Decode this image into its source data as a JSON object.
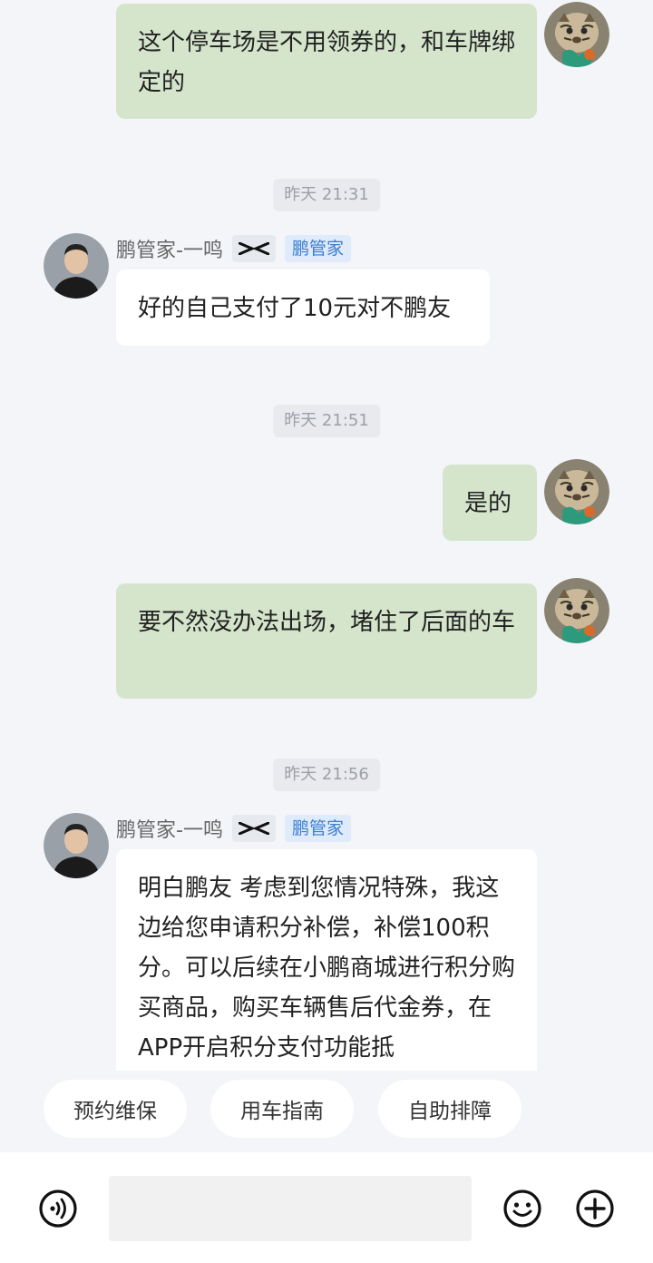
{
  "messages": [
    {
      "direction": "out",
      "text": "这个停车场是不用领券的，和车牌绑定的"
    },
    {
      "timestamp": "昨天 21:31"
    },
    {
      "direction": "in",
      "sender": "鹏管家-一鸣",
      "badge": "鹏管家",
      "text": "好的自己支付了10元对不鹏友"
    },
    {
      "timestamp": "昨天 21:51"
    },
    {
      "direction": "out",
      "text": "是的"
    },
    {
      "direction": "out",
      "text": "要不然没办法出场，堵住了后面的车"
    },
    {
      "timestamp": "昨天 21:56"
    },
    {
      "direction": "in",
      "sender": "鹏管家-一鸣",
      "badge": "鹏管家",
      "text": "明白鹏友 考虑到您情况特殊，我这边给您申请积分补偿，补偿100积分。可以后续在小鹏商城进行积分购买商品，购买车辆售后代金券，在APP开启积分支付功能抵"
    }
  ],
  "quick_replies": [
    "预约维保",
    "用车指南",
    "自助排障"
  ],
  "input": {
    "placeholder": "",
    "value": ""
  },
  "icons": {
    "voice": "voice-icon",
    "emoji": "emoji-icon",
    "plus": "plus-icon",
    "brand": "xpeng-logo-icon"
  },
  "colors": {
    "outgoing_bubble": "#d5e5cc",
    "incoming_bubble": "#ffffff",
    "background": "#f3f5f9",
    "badge_text": "#3a7fd0"
  }
}
